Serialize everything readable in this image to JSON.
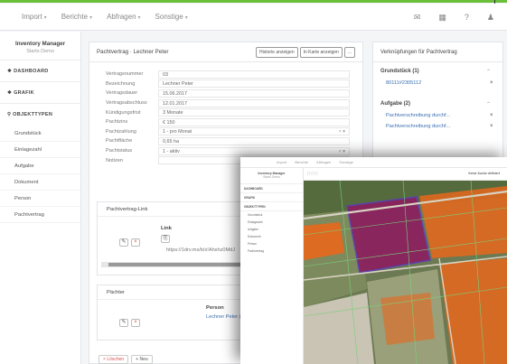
{
  "topnav": {
    "menu": [
      "Import",
      "Berichte",
      "Abfragen",
      "Sonstige"
    ],
    "icons": [
      "mail-icon",
      "calendar-icon",
      "help-icon",
      "user-icon"
    ]
  },
  "sidebar": {
    "app_title": "Inventory Manager",
    "app_subtitle": "Starts Demo",
    "sections": {
      "dashboard": "DASHBOARD",
      "grafik": "GRAFIK",
      "objekttypen": "OBJEKTTYPEN"
    },
    "items": [
      {
        "label": "Grundstück"
      },
      {
        "label": "Einlagezahl"
      },
      {
        "label": "Aufgabe"
      },
      {
        "label": "Dokument"
      },
      {
        "label": "Person"
      },
      {
        "label": "Pachtvertrag"
      }
    ]
  },
  "main": {
    "title": "Pachtvertrag · Lechner Peter",
    "header_buttons": [
      "Historie anzeigen",
      "In Karte anzeigen",
      "..."
    ],
    "fields": [
      {
        "label": "Vertragsnummer",
        "value": "03"
      },
      {
        "label": "Bezeichnung",
        "value": "Lechner Peter"
      },
      {
        "label": "Vertragsdauer",
        "value": "15.06.2017"
      },
      {
        "label": "Vertragsabschluss",
        "value": "12.01.2017"
      },
      {
        "label": "Kündigungsfrist",
        "value": "3 Monate"
      },
      {
        "label": "Pachtzins",
        "value": "€ 150"
      },
      {
        "label": "Pachtzahlung",
        "value": "1 - pro Monat"
      },
      {
        "label": "Pachtfläche",
        "value": "0,65 ha"
      },
      {
        "label": "Pachtstatus",
        "value": "1 - aktiv"
      },
      {
        "label": "Notizen",
        "value": ""
      }
    ],
    "link_panel": {
      "title": "Pachtvertrag-Link",
      "column": "Link",
      "value": "https://1drv.ms/b/s!Ahshz0MdJ"
    },
    "pachter_panel": {
      "title": "Pächter",
      "column": "Person",
      "value": "Lechner Peter (1)"
    },
    "footer": {
      "delete_label": "Löschen",
      "new_label": "Neu"
    }
  },
  "right": {
    "title": "Verknüpfungen für Pachtvertrag",
    "groups": [
      {
        "label": "Grundstück (1)",
        "items": [
          "80111#2305112"
        ]
      },
      {
        "label": "Aufgabe (2)",
        "items": [
          "Pachtverschreibung durchf...",
          "Pachtverschreibung durchf..."
        ]
      }
    ]
  },
  "overlay": {
    "menu": [
      "Import",
      "Berichte",
      "Abfragen",
      "Sonstige"
    ],
    "app_title": "Inventory Manager",
    "app_subtitle": "Starts Demo",
    "sections": [
      "DASHBOARD",
      "GRAFIK",
      "OBJEKTTYPEN"
    ],
    "items": [
      "Grundstück",
      "Einlagezahl",
      "Aufgabe",
      "Dokument",
      "Person",
      "Pachtvertrag"
    ],
    "tool_label": "Keine Suche definiert"
  },
  "colors": {
    "accent": "#6abf3b",
    "link": "#3a6fb0",
    "delete": "#d9534f",
    "highlight_parcel": "#8b1f5e",
    "field_orange": "#e8671c"
  }
}
